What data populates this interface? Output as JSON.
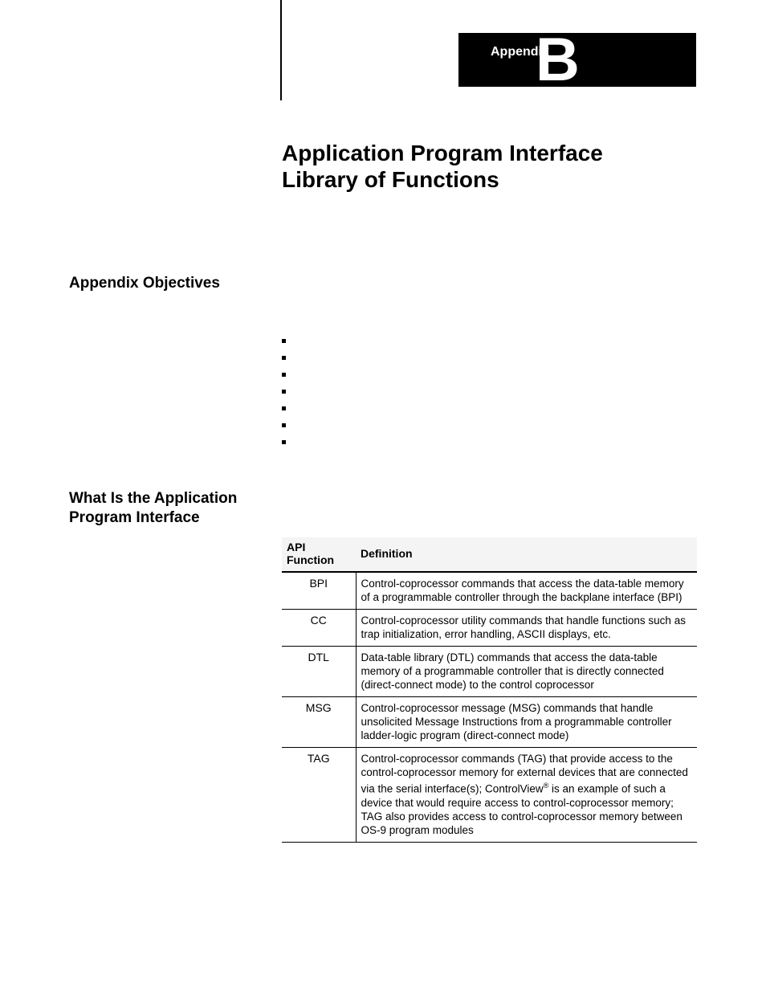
{
  "appendix": {
    "label": "Appendix",
    "letter": "B"
  },
  "title_line1": "Application Program Interface",
  "title_line2": "Library of Functions",
  "headings": {
    "objectives": "Appendix Objectives",
    "what_is_line1": "What Is the Application",
    "what_is_line2": "Program Interface"
  },
  "bullet_count": 7,
  "table": {
    "headers": {
      "func": "API Function",
      "def": "Definition"
    },
    "rows": [
      {
        "func": "BPI",
        "def": "Control-coprocessor commands that access the data-table memory of a programmable controller through the backplane interface (BPI)"
      },
      {
        "func": "CC",
        "def": "Control-coprocessor utility commands that handle functions such as trap initialization, error handling, ASCII displays, etc."
      },
      {
        "func": "DTL",
        "def": "Data-table library (DTL) commands that access the data-table memory of a programmable controller that is directly connected (direct-connect mode) to the control coprocessor"
      },
      {
        "func": "MSG",
        "def": "Control-coprocessor message (MSG) commands that handle unsolicited Message Instructions from a programmable controller ladder-logic program (direct-connect mode)"
      },
      {
        "func": "TAG",
        "def_pre": "Control-coprocessor commands (TAG) that provide access to the control-coprocessor memory for external devices that are connected via the serial interface(s); ControlView",
        "def_post": " is an example of such a device that would require access to control-coprocessor memory; TAG also provides access to control-coprocessor memory between OS-9 program modules"
      }
    ]
  }
}
